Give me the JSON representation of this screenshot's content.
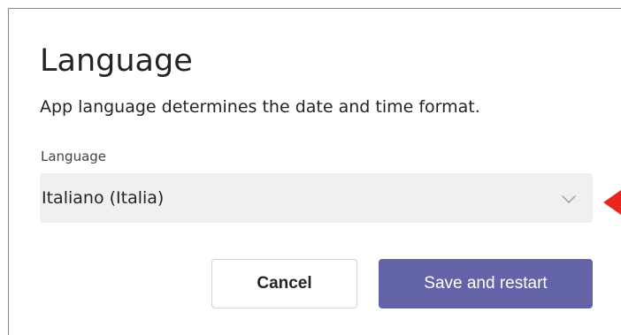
{
  "dialog": {
    "title": "Language",
    "subtitle": "App language determines the date and time format."
  },
  "language_field": {
    "label": "Language",
    "selected_value": "Italiano (Italia)",
    "icon": "chevron-down-icon"
  },
  "buttons": {
    "cancel_label": "Cancel",
    "save_label": "Save and restart"
  },
  "colors": {
    "primary_button": "#6264a7",
    "select_background": "#f0f0f0",
    "annotation_arrow": "#e8261f"
  }
}
